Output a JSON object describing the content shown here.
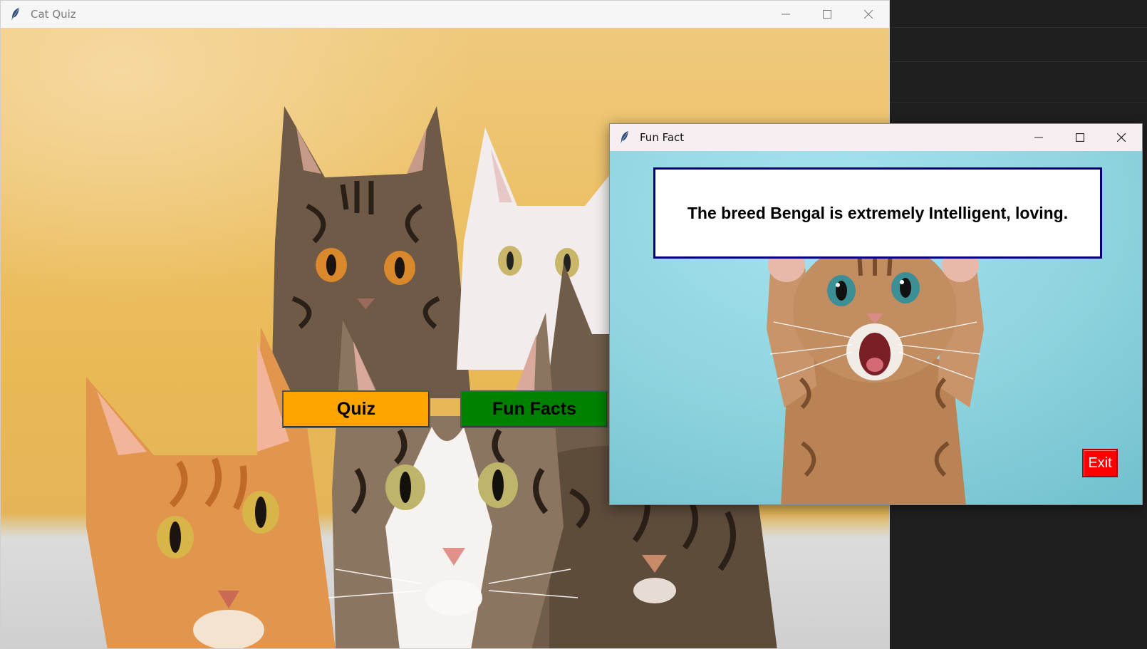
{
  "main_window": {
    "title": "Cat Quiz",
    "quiz_label": "Quiz",
    "fun_facts_label": "Fun Facts",
    "quiz_color": "#ffa500",
    "fun_facts_color": "#008000"
  },
  "fact_window": {
    "title": "Fun Fact",
    "fact_text": "The breed Bengal is extremely Intelligent, loving.",
    "exit_label": "Exit",
    "exit_color": "#ff0000",
    "box_border_color": "#000080"
  },
  "icons": {
    "app": "feather-icon",
    "minimize": "minimize-icon",
    "maximize": "maximize-icon",
    "close": "close-icon"
  }
}
